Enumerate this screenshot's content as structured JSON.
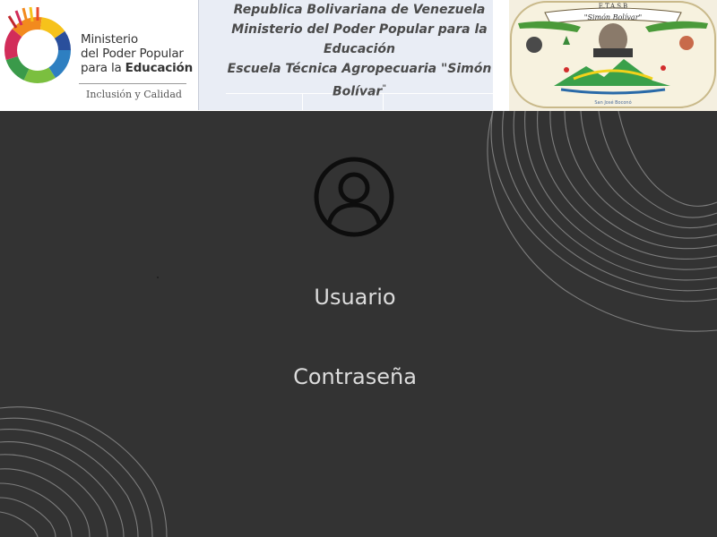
{
  "header": {
    "ministry": {
      "line1": "Ministerio",
      "line2": "del Poder Popular",
      "line3_prefix": "para la ",
      "line3_bold": "Educación",
      "tagline": "Inclusión y Calidad"
    },
    "school": {
      "line1": "Republica Bolivariana de Venezuela",
      "line2": "Ministerio del Poder Popular para la",
      "line3": "Educación",
      "line4": "Escuela Técnica Agropecuaria \"Simón",
      "line5": "Bolívar",
      "line5_suffix": "\""
    },
    "crest": {
      "top_text": "E.T.A.S.B",
      "banner_text": "\"Simón Bolívar\"",
      "bottom_text": "San José Boconó"
    }
  },
  "login": {
    "avatar_icon": "user-circle-icon",
    "user_label": "Usuario",
    "password_label": "Contraseña"
  },
  "colors": {
    "background": "#333333",
    "label_text": "#dcdcdc",
    "header_bg": "#ffffff",
    "school_box_bg": "#e9edf5"
  }
}
